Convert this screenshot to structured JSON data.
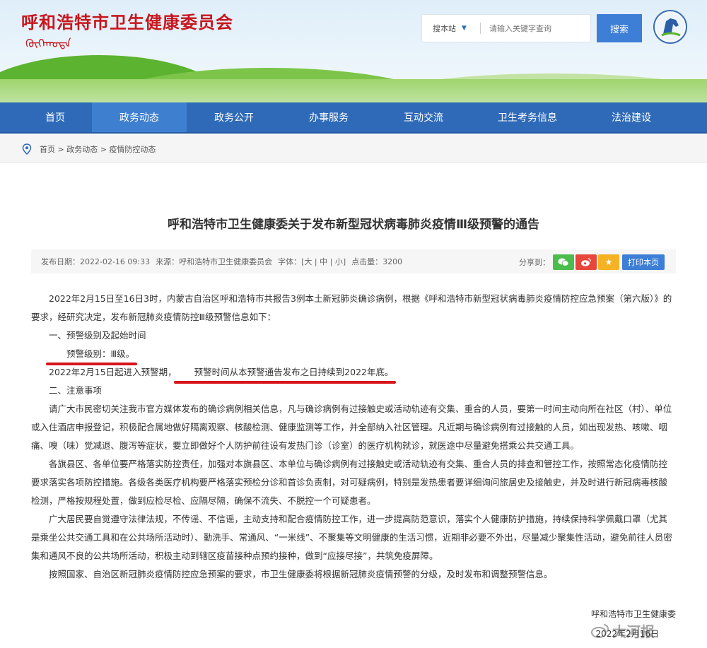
{
  "header": {
    "site_title": "呼和浩特市卫生健康委员会",
    "site_subtitle": "ᠬᠥᠬᠡᠬᠣᠲᠠ",
    "search_scope": "搜本站",
    "search_placeholder": "请输入关键字查询",
    "search_button": "搜索"
  },
  "nav": {
    "items": [
      {
        "label": "首页"
      },
      {
        "label": "政务动态"
      },
      {
        "label": "政务公开"
      },
      {
        "label": "办事服务"
      },
      {
        "label": "互动交流"
      },
      {
        "label": "卫生考务信息"
      },
      {
        "label": "法治建设"
      }
    ],
    "active_index": 1
  },
  "breadcrumb": {
    "text": "首页 > 政务动态 > 疫情防控动态"
  },
  "article": {
    "title": "呼和浩特市卫生健康委关于发布新型冠状病毒肺炎疫情Ⅲ级预警的通告",
    "meta": {
      "date": "发布日期：2022-02-16 09:33",
      "source": "来源：呼和浩特市卫生健康委员会",
      "font": "字体：[大 | 中 | 小]",
      "clicks": "点击量：3200"
    },
    "share_label": "分享到：",
    "print_label": "打印本页",
    "paragraphs": {
      "p1": "2022年2月15日至16日3时，内蒙古自治区呼和浩特市共报告3例本土新冠肺炎确诊病例，根据《呼和浩特市新型冠状病毒肺炎疫情防控应急预案（第六版）》的要求，经研究决定，发布新冠肺炎疫情防控Ⅲ级预警信息如下：",
      "h1": "一、预警级别及起始时间",
      "level": "预警级别：Ⅲ级。",
      "p2a": "2022年2月15日起进入预警期，",
      "p2b": "预警时间从本预警通告发布之日持续到2022年底。",
      "h2": "二、注意事项",
      "p3": "请广大市民密切关注我市官方媒体发布的确诊病例相关信息，凡与确诊病例有过接触史或活动轨迹有交集、重合的人员，要第一时间主动向所在社区（村）、单位或入住酒店申报登记，积极配合属地做好隔离观察、核酸检测、健康监测等工作，并全部纳入社区管理。凡近期与确诊病例有过接触的人员，如出现发热、咳嗽、咽痛、嗅（味）觉减退、腹泻等症状，要立即做好个人防护前往设有发热门诊（诊室）的医疗机构就诊，就医途中尽量避免搭乘公共交通工具。",
      "p4": "各旗县区、各单位要严格落实防控责任，加强对本旗县区、本单位与确诊病例有过接触史或活动轨迹有交集、重合人员的排查和管控工作，按照常态化疫情防控要求落实各项防控措施。各级各类医疗机构要严格落实预检分诊和首诊负责制，对可疑病例，特别是发热患者要详细询问旅居史及接触史，并及时进行新冠病毒核酸检测，严格按规程处置，做到应检尽检、应隔尽隔，确保不流失、不脱控一个可疑患者。",
      "p5": "广大居民要自觉遵守法律法规，不传谣、不信谣，主动支持和配合疫情防控工作，进一步提高防范意识，落实个人健康防护措施，持续保持科学佩戴口罩（尤其是乘坐公共交通工具和在公共场所活动时）、勤洗手、常通风、“一米线”、不聚集等文明健康的生活习惯，近期非必要不外出，尽量减少聚集性活动，避免前往人员密集和通风不良的公共场所活动，积极主动到辖区疫苗接种点预约接种，做到“应接尽接”，共筑免疫屏障。",
      "p6": "按照国家、自治区新冠肺炎疫情防控应急预案的要求，市卫生健康委将根据新冠肺炎疫情预警的分级，及时发布和调整预警信息。"
    },
    "signature": "呼和浩特市卫生健康委",
    "date": "2022年2月16日"
  },
  "watermark": "大河报",
  "colors": {
    "nav_bg": "#2f6ab8",
    "nav_active": "#3f7fd0",
    "title_red": "#c8161d",
    "underline_red": "#d8141a",
    "button_blue": "#3d7ed6"
  }
}
